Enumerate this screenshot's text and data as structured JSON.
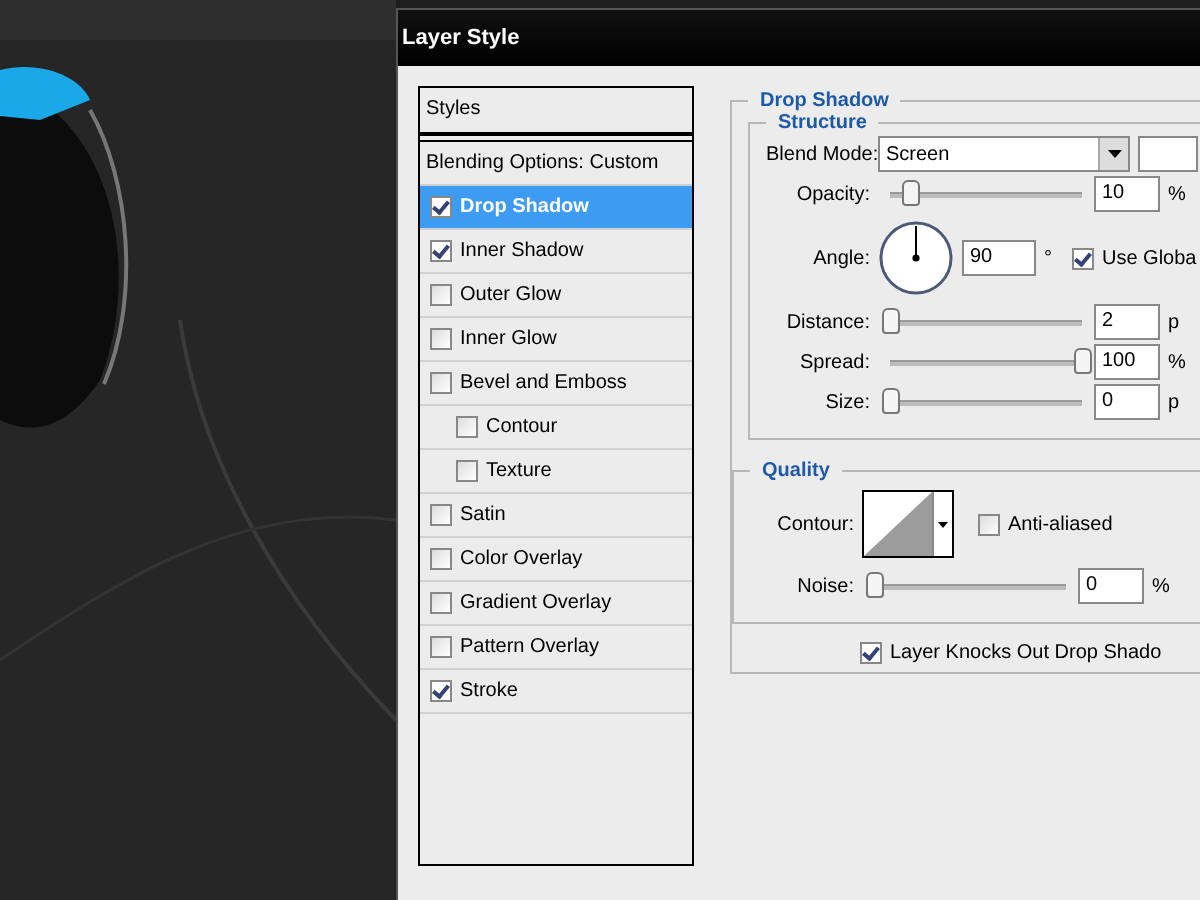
{
  "dialog": {
    "title": "Layer Style"
  },
  "styles_panel": {
    "header": "Styles",
    "blending_options": "Blending Options: Custom",
    "items": [
      {
        "label": "Drop Shadow",
        "checked": true,
        "selected": true
      },
      {
        "label": "Inner Shadow",
        "checked": true,
        "selected": false
      },
      {
        "label": "Outer Glow",
        "checked": false,
        "selected": false
      },
      {
        "label": "Inner Glow",
        "checked": false,
        "selected": false
      },
      {
        "label": "Bevel and Emboss",
        "checked": false,
        "selected": false,
        "children": [
          {
            "label": "Contour",
            "checked": false,
            "selected": false
          },
          {
            "label": "Texture",
            "checked": false,
            "selected": false
          }
        ]
      },
      {
        "label": "Satin",
        "checked": false,
        "selected": false
      },
      {
        "label": "Color Overlay",
        "checked": false,
        "selected": false
      },
      {
        "label": "Gradient Overlay",
        "checked": false,
        "selected": false
      },
      {
        "label": "Pattern Overlay",
        "checked": false,
        "selected": false
      },
      {
        "label": "Stroke",
        "checked": true,
        "selected": false
      }
    ]
  },
  "drop_shadow": {
    "title": "Drop Shadow",
    "structure": {
      "title": "Structure",
      "blend_mode": {
        "label": "Blend Mode:",
        "value": "Screen"
      },
      "opacity": {
        "label": "Opacity:",
        "level": 0.1,
        "value": "10",
        "unit": "%"
      },
      "angle": {
        "label": "Angle:",
        "value": "90",
        "unit": "°",
        "use_global": {
          "label": "Use Globa",
          "checked": true
        }
      },
      "distance": {
        "label": "Distance:",
        "level": 0,
        "value": "2",
        "unit": "p"
      },
      "spread": {
        "label": "Spread:",
        "level": 1,
        "value": "100",
        "unit": "%"
      },
      "size": {
        "label": "Size:",
        "level": 0,
        "value": "0",
        "unit": "p"
      }
    },
    "quality": {
      "title": "Quality",
      "contour": {
        "label": "Contour:"
      },
      "anti_aliased": {
        "label": "Anti-aliased",
        "checked": false
      },
      "noise": {
        "label": "Noise:",
        "level": 0,
        "value": "0",
        "unit": "%"
      }
    },
    "knocks_out": {
      "label": "Layer Knocks Out Drop Shado",
      "checked": true
    }
  }
}
